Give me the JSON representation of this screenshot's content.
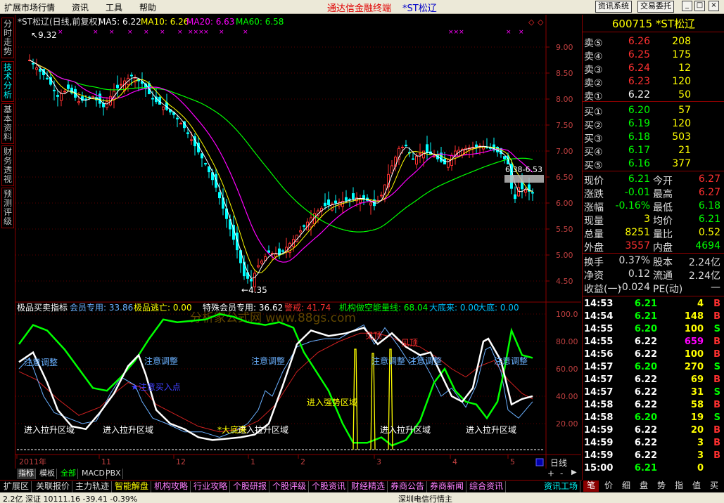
{
  "menubar": {
    "items": [
      "扩展市场行情",
      "资讯",
      "工具",
      "帮助"
    ],
    "brand": "通达信金融终端",
    "stock": "*ST松辽",
    "buttons": [
      "资讯系统",
      "交易委托"
    ]
  },
  "left_tabs": [
    "分时走势",
    "技术分析",
    "基本资料",
    "财务透视",
    "预测评级"
  ],
  "main": {
    "header": "*ST松辽(日线,前复权)",
    "ma": [
      {
        "label": "MA5: 6.22",
        "color": "#ffffff"
      },
      {
        "label": "MA10: 6.26",
        "color": "#ffff00"
      },
      {
        "label": "MA20: 6.63",
        "color": "#ff00ff"
      },
      {
        "label": "MA60: 6.58",
        "color": "#00ff00"
      }
    ],
    "price_axis": [
      "9.00",
      "8.50",
      "8.00",
      "7.50",
      "7.00",
      "6.50",
      "6.00",
      "5.50",
      "5.00",
      "4.50"
    ],
    "max_label": "9.32",
    "min_label": "4.35",
    "range_label": "6.38-6.53",
    "date_labels": [
      "2011年",
      "11",
      "12",
      "1",
      "2",
      "3",
      "4",
      "5"
    ],
    "period": "日线"
  },
  "indicator": {
    "title": "极品买卖指标",
    "values": [
      {
        "label": "会员专用: 33.86",
        "color": "#6ab0ff"
      },
      {
        "label": "极品逃亡: 0.00",
        "color": "#ffff00"
      },
      {
        "label": "特殊会员专用: 36.62",
        "color": "#ffffff"
      },
      {
        "label": "警戒: 41.74",
        "color": "#ff3030"
      },
      {
        "label": "机构做空能量线: 68.04",
        "color": "#00ff00"
      },
      {
        "label": "大底来: 0.00",
        "color": "#00c0ff"
      },
      {
        "label": "大底: 0.00",
        "color": "#00c0ff"
      }
    ],
    "axis": [
      "100.0",
      "80.00",
      "60.00",
      "40.00",
      "20.00"
    ],
    "watermark": "分析家公式网 www.88gs.com",
    "annotations": {
      "caution": "注意调整",
      "pullup": "进入拉升区域",
      "strong": "进入强势区域",
      "buy": "★注意买入点",
      "bottom": "*大底来",
      "top": "见顶"
    }
  },
  "quote": {
    "code": "600715",
    "name": "*ST松辽",
    "asks": [
      {
        "label": "卖⑤",
        "price": "6.26",
        "vol": "208"
      },
      {
        "label": "卖④",
        "price": "6.25",
        "vol": "175"
      },
      {
        "label": "卖③",
        "price": "6.24",
        "vol": "12"
      },
      {
        "label": "卖②",
        "price": "6.23",
        "vol": "120"
      },
      {
        "label": "卖①",
        "price": "6.22",
        "vol": "50"
      }
    ],
    "bids": [
      {
        "label": "买①",
        "price": "6.20",
        "vol": "57"
      },
      {
        "label": "买②",
        "price": "6.19",
        "vol": "120"
      },
      {
        "label": "买③",
        "price": "6.18",
        "vol": "503"
      },
      {
        "label": "买④",
        "price": "6.17",
        "vol": "21"
      },
      {
        "label": "买⑤",
        "price": "6.16",
        "vol": "377"
      }
    ],
    "stats": [
      {
        "l1": "现价",
        "v1": "6.21",
        "c1": "#00ff00",
        "l2": "今开",
        "v2": "6.27",
        "c2": "#ff3030"
      },
      {
        "l1": "涨跌",
        "v1": "-0.01",
        "c1": "#00ff00",
        "l2": "最高",
        "v2": "6.27",
        "c2": "#ff3030"
      },
      {
        "l1": "涨幅",
        "v1": "-0.16%",
        "c1": "#00ff00",
        "l2": "最低",
        "v2": "6.18",
        "c2": "#00ff00"
      },
      {
        "l1": "现量",
        "v1": "3",
        "c1": "#ffff00",
        "l2": "均价",
        "v2": "6.21",
        "c2": "#00ff00"
      },
      {
        "l1": "总量",
        "v1": "8251",
        "c1": "#ffff00",
        "l2": "量比",
        "v2": "0.52",
        "c2": "#ffff00"
      },
      {
        "l1": "外盘",
        "v1": "3557",
        "c1": "#ff3030",
        "l2": "内盘",
        "v2": "4694",
        "c2": "#00ff00"
      }
    ],
    "stats2": [
      {
        "l1": "换手",
        "v1": "0.37%",
        "l2": "股本",
        "v2": "2.24亿"
      },
      {
        "l1": "净资",
        "v1": "0.12",
        "l2": "流通",
        "v2": "2.24亿"
      },
      {
        "l1": "收益(一)",
        "v1": "-0.024",
        "l2": "PE(动)",
        "v2": "—"
      }
    ],
    "ticks": [
      {
        "time": "14:53",
        "price": "6.21",
        "vol": "4",
        "bs": "B",
        "pc": "#00ff00",
        "vc": "#ffff00",
        "bc": "#ff3030"
      },
      {
        "time": "14:54",
        "price": "6.21",
        "vol": "148",
        "bs": "B",
        "pc": "#00ff00",
        "vc": "#ffff00",
        "bc": "#ff3030"
      },
      {
        "time": "14:55",
        "price": "6.20",
        "vol": "100",
        "bs": "S",
        "pc": "#00ff00",
        "vc": "#ffff00",
        "bc": "#00ff00"
      },
      {
        "time": "14:55",
        "price": "6.22",
        "vol": "659",
        "bs": "B",
        "pc": "#ffffff",
        "vc": "#ff00ff",
        "bc": "#ff3030"
      },
      {
        "time": "14:56",
        "price": "6.22",
        "vol": "100",
        "bs": "B",
        "pc": "#ffffff",
        "vc": "#ffff00",
        "bc": "#ff3030"
      },
      {
        "time": "14:57",
        "price": "6.20",
        "vol": "270",
        "bs": "S",
        "pc": "#00ff00",
        "vc": "#ffff00",
        "bc": "#00ff00"
      },
      {
        "time": "14:57",
        "price": "6.22",
        "vol": "69",
        "bs": "B",
        "pc": "#ffffff",
        "vc": "#ffff00",
        "bc": "#ff3030"
      },
      {
        "time": "14:57",
        "price": "6.22",
        "vol": "31",
        "bs": "S",
        "pc": "#ffffff",
        "vc": "#ffff00",
        "bc": "#00ff00"
      },
      {
        "time": "14:58",
        "price": "6.22",
        "vol": "58",
        "bs": "B",
        "pc": "#ffffff",
        "vc": "#ffff00",
        "bc": "#ff3030"
      },
      {
        "time": "14:58",
        "price": "6.20",
        "vol": "19",
        "bs": "S",
        "pc": "#00ff00",
        "vc": "#ffff00",
        "bc": "#00ff00"
      },
      {
        "time": "14:59",
        "price": "6.22",
        "vol": "20",
        "bs": "B",
        "pc": "#ffffff",
        "vc": "#ffff00",
        "bc": "#ff3030"
      },
      {
        "time": "14:59",
        "price": "6.22",
        "vol": "3",
        "bs": "B",
        "pc": "#ffffff",
        "vc": "#ffff00",
        "bc": "#ff3030"
      },
      {
        "time": "14:59",
        "price": "6.22",
        "vol": "3",
        "bs": "B",
        "pc": "#ffffff",
        "vc": "#ffff00",
        "bc": "#ff3030"
      },
      {
        "time": "15:00",
        "price": "6.21",
        "vol": "0",
        "bs": "",
        "pc": "#00ff00",
        "vc": "#ffff00",
        "bc": "#ff3030"
      }
    ]
  },
  "side_tabs": [
    "笔",
    "价",
    "细",
    "盘",
    "势",
    "指",
    "值",
    "买"
  ],
  "bottom_tabs": [
    "指标",
    "模板",
    "全部",
    "MACD",
    "PBX"
  ],
  "bottom_bar": [
    "扩展区",
    "关联报价",
    "主力轨迹",
    "智能解盘",
    "机构攻略",
    "行业攻略",
    "个股研报",
    "个股评级",
    "个股资讯",
    "财经精选",
    "券商公告",
    "券商新闻",
    "综合资讯"
  ],
  "bottom_right": "资讯工场",
  "ticker": [
    "2.2亿 深证 10111.16 -39.41 -0.39%",
    "深圳电信行情主"
  ]
}
